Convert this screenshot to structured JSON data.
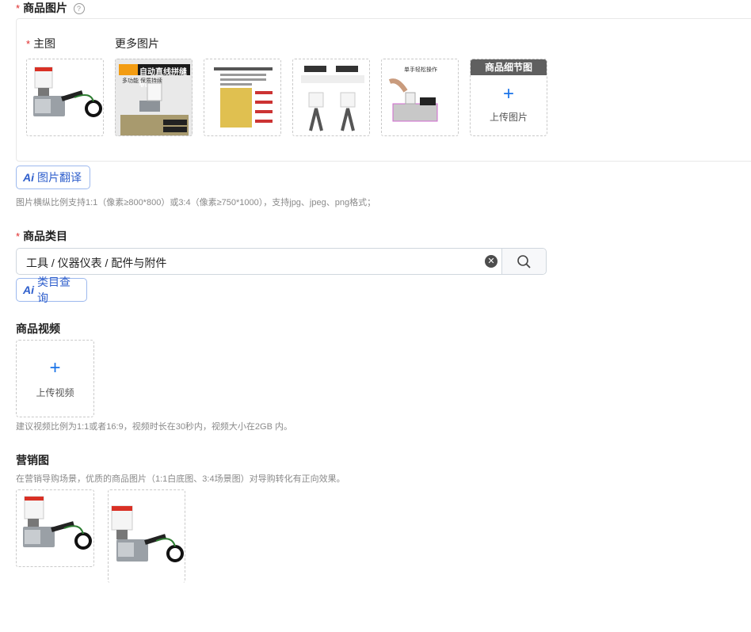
{
  "product_images": {
    "title": "商品图片",
    "required": "*",
    "main_label": "主图",
    "more_label": "更多图片",
    "detail_tag": "商品细节图",
    "upload_label": "上传图片",
    "ai_translate_label": "图片翻译",
    "hint": "图片横纵比例支持1:1（像素≥800*800）或3:4（像素≥750*1000），支持jpg、jpeg、png格式；",
    "thumb2_banner": "自动直线拼缝机",
    "thumb2_sub": "多功能 保质持续",
    "thumb6_text": "单手轻松操作"
  },
  "category": {
    "title": "商品类目",
    "required": "*",
    "value": "工具 / 仪器仪表 / 配件与附件",
    "ai_query_label": "类目查询"
  },
  "video": {
    "title": "商品视频",
    "upload_label": "上传视频",
    "hint": "建议视频比例为1:1或者16:9，视频时长在30秒内，视频大小在2GB 内。"
  },
  "marketing": {
    "title": "营销图",
    "hint": "在营销导购场景，优质的商品图片（1:1白底图、3:4场景图）对导购转化有正向效果。"
  },
  "ai_mark": "Ai",
  "colors": {
    "accent": "#1a73e8",
    "required": "#e02a2a",
    "ai": "#2f5fcc"
  }
}
